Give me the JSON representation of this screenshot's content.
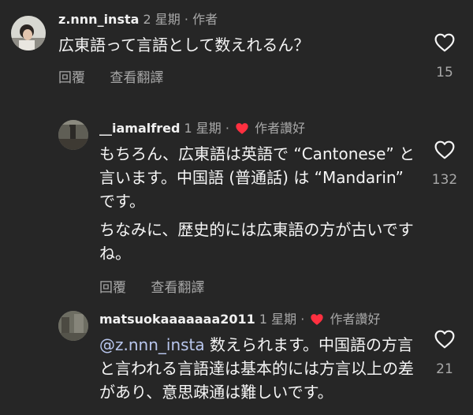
{
  "comments": [
    {
      "username": "z.nnn_insta",
      "time": "2 星期",
      "badge": "作者",
      "author_liked": false,
      "text": [
        "広東語って言語として数えれるん？"
      ],
      "reply": "回覆",
      "translate": "查看翻譯",
      "likes": "15"
    },
    {
      "username": "__iamalfred",
      "time": "1 星期",
      "badge": "作者讚好",
      "author_liked": true,
      "text": [
        "もちろん、広東語は英語で “Cantonese” と言います。中国語 (普通話) は “Mandarin” です。",
        "ちなみに、歴史的には広東語の方が古いですね。"
      ],
      "reply": "回覆",
      "translate": "查看翻譯",
      "likes": "132"
    },
    {
      "username": "matsuokaaaaaaa2011",
      "time": "1 星期",
      "badge": "作者讚好",
      "author_liked": true,
      "mention": "@z.nnn_insta",
      "text": [
        " 数えられます。中国語の方言と言われる言語達は基本的には方言以上の差があり、意思疎通は難しいです。"
      ],
      "likes": "21"
    }
  ],
  "separator": "·",
  "colors": {
    "background": "#262626",
    "author_like_heart": "#ff3040",
    "mention": "#b9c7ee",
    "muted_text": "#a8a8a8"
  },
  "icons": {
    "like": "heart-outline-icon",
    "author_like": "heart-filled-icon"
  }
}
